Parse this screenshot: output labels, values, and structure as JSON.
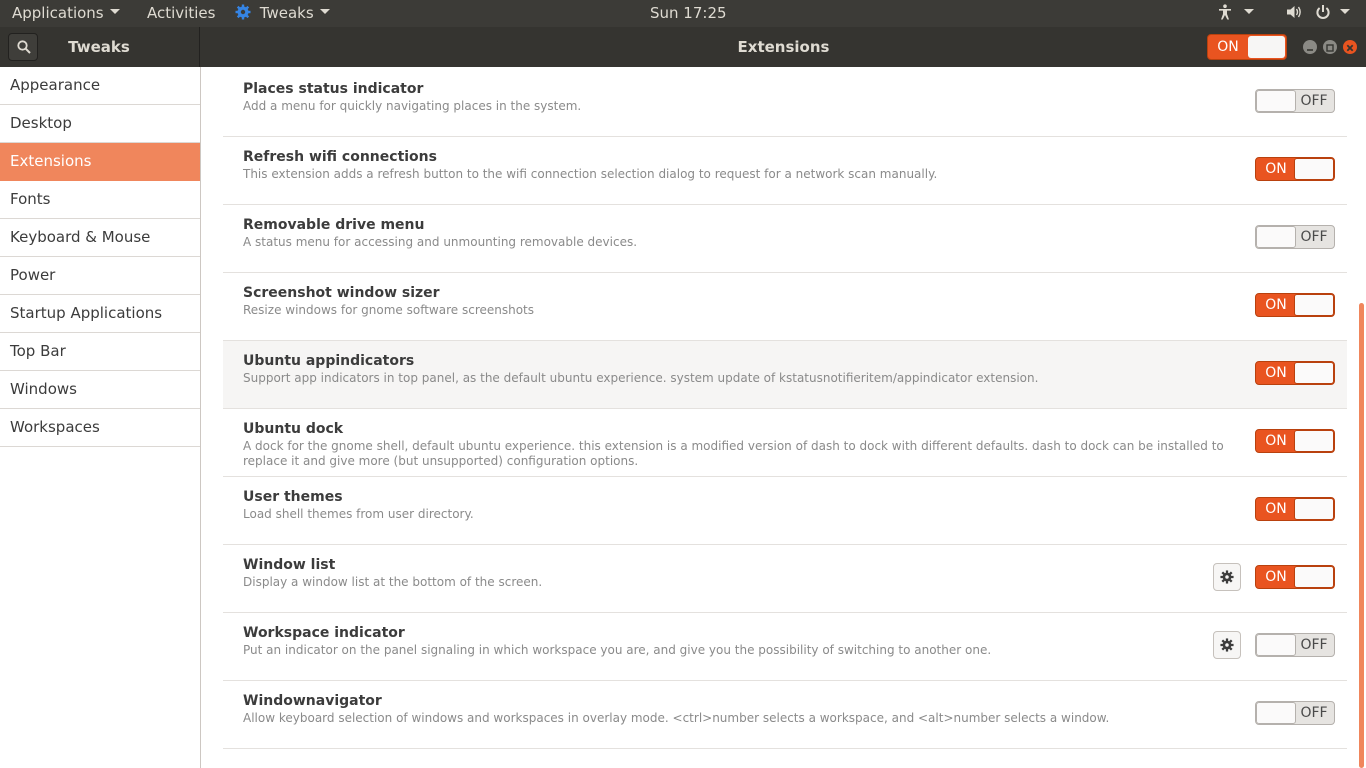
{
  "topbar": {
    "applications": "Applications",
    "activities": "Activities",
    "app_name": "Tweaks",
    "clock": "Sun 17:25",
    "icons": [
      "accessibility-icon",
      "volume-icon",
      "power-icon"
    ]
  },
  "header": {
    "left_title": "Tweaks",
    "main_title": "Extensions",
    "global_switch": "ON"
  },
  "sidebar": {
    "active": "Extensions",
    "items": [
      {
        "label": "Appearance"
      },
      {
        "label": "Desktop"
      },
      {
        "label": "Extensions"
      },
      {
        "label": "Fonts"
      },
      {
        "label": "Keyboard & Mouse"
      },
      {
        "label": "Power"
      },
      {
        "label": "Startup Applications"
      },
      {
        "label": "Top Bar"
      },
      {
        "label": "Windows"
      },
      {
        "label": "Workspaces"
      }
    ]
  },
  "extensions": [
    {
      "title": "Places status indicator",
      "desc": "Add a menu for quickly navigating places in the system.",
      "state": "OFF",
      "settings": false
    },
    {
      "title": "Refresh wifi connections",
      "desc": "This extension adds a refresh button to the wifi connection selection dialog to request for a network scan manually.",
      "state": "ON",
      "settings": false
    },
    {
      "title": "Removable drive menu",
      "desc": "A status menu for accessing and unmounting removable devices.",
      "state": "OFF",
      "settings": false
    },
    {
      "title": "Screenshot window sizer",
      "desc": "Resize windows for gnome software screenshots",
      "state": "ON",
      "settings": false
    },
    {
      "title": "Ubuntu appindicators",
      "desc": "Support app indicators in top panel, as the default ubuntu experience. system update of kstatusnotifieritem/appindicator extension.",
      "state": "ON",
      "settings": false
    },
    {
      "title": "Ubuntu dock",
      "desc": "A dock for the gnome shell, default ubuntu experience. this extension is a modified version of dash to dock with different defaults. dash to dock can be installed to replace it and give more (but unsupported) configuration options.",
      "state": "ON",
      "settings": false
    },
    {
      "title": "User themes",
      "desc": "Load shell themes from user directory.",
      "state": "ON",
      "settings": false
    },
    {
      "title": "Window list",
      "desc": "Display a window list at the bottom of the screen.",
      "state": "ON",
      "settings": true
    },
    {
      "title": "Workspace indicator",
      "desc": "Put an indicator on the panel signaling in which workspace you are, and give you the possibility of switching to another one.",
      "state": "OFF",
      "settings": true
    },
    {
      "title": "Windownavigator",
      "desc": "Allow keyboard selection of windows and workspaces in overlay mode. <ctrl>number selects a workspace, and <alt>number selects a window.",
      "state": "OFF",
      "settings": false
    }
  ],
  "colors": {
    "accent": "#e95420",
    "sidebar_active": "#f0865c",
    "topbar": "#3c3b37",
    "headerbar": "#353430"
  }
}
